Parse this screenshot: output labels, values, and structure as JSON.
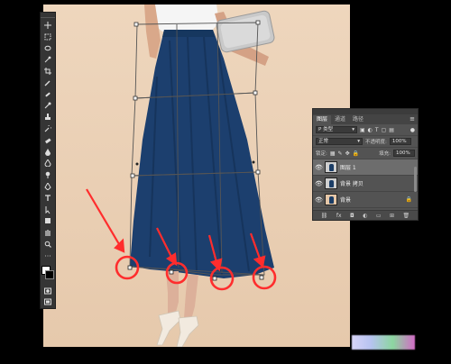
{
  "toolbar": {
    "tools": [
      {
        "name": "move-tool-icon"
      },
      {
        "name": "marquee-tool-icon"
      },
      {
        "name": "lasso-tool-icon"
      },
      {
        "name": "quick-select-tool-icon"
      },
      {
        "name": "crop-tool-icon"
      },
      {
        "name": "eyedropper-tool-icon"
      },
      {
        "name": "healing-brush-tool-icon"
      },
      {
        "name": "brush-tool-icon"
      },
      {
        "name": "clone-stamp-tool-icon"
      },
      {
        "name": "history-brush-tool-icon"
      },
      {
        "name": "eraser-tool-icon"
      },
      {
        "name": "gradient-tool-icon"
      },
      {
        "name": "blur-tool-icon"
      },
      {
        "name": "dodge-tool-icon"
      },
      {
        "name": "pen-tool-icon"
      },
      {
        "name": "type-tool-icon"
      },
      {
        "name": "path-select-tool-icon"
      },
      {
        "name": "shape-tool-icon"
      },
      {
        "name": "hand-tool-icon"
      },
      {
        "name": "zoom-tool-icon"
      }
    ],
    "foreground_color": "#ffffff",
    "background_color": "#000000"
  },
  "layers_panel": {
    "tabs": [
      "图层",
      "通道",
      "路径"
    ],
    "filter_label": "P 类型",
    "blend_mode": "正常",
    "opacity_label": "不透明度:",
    "opacity_value": "100%",
    "lock_label": "锁定:",
    "fill_label": "填充:",
    "fill_value": "100%",
    "layers": [
      {
        "name": "图层 1",
        "visible": true,
        "selected": true
      },
      {
        "name": "背景 拷贝",
        "visible": true,
        "selected": false
      },
      {
        "name": "背景",
        "visible": true,
        "selected": false,
        "locked": true
      }
    ],
    "footer_icons": [
      "link-icon",
      "fx-icon",
      "mask-icon",
      "adjustment-icon",
      "group-icon",
      "new-layer-icon",
      "trash-icon"
    ]
  },
  "canvas": {
    "accent_color": "#ff2d2d",
    "skirt_color": "#1c3f6e",
    "background_color": "#e9cfb4"
  }
}
